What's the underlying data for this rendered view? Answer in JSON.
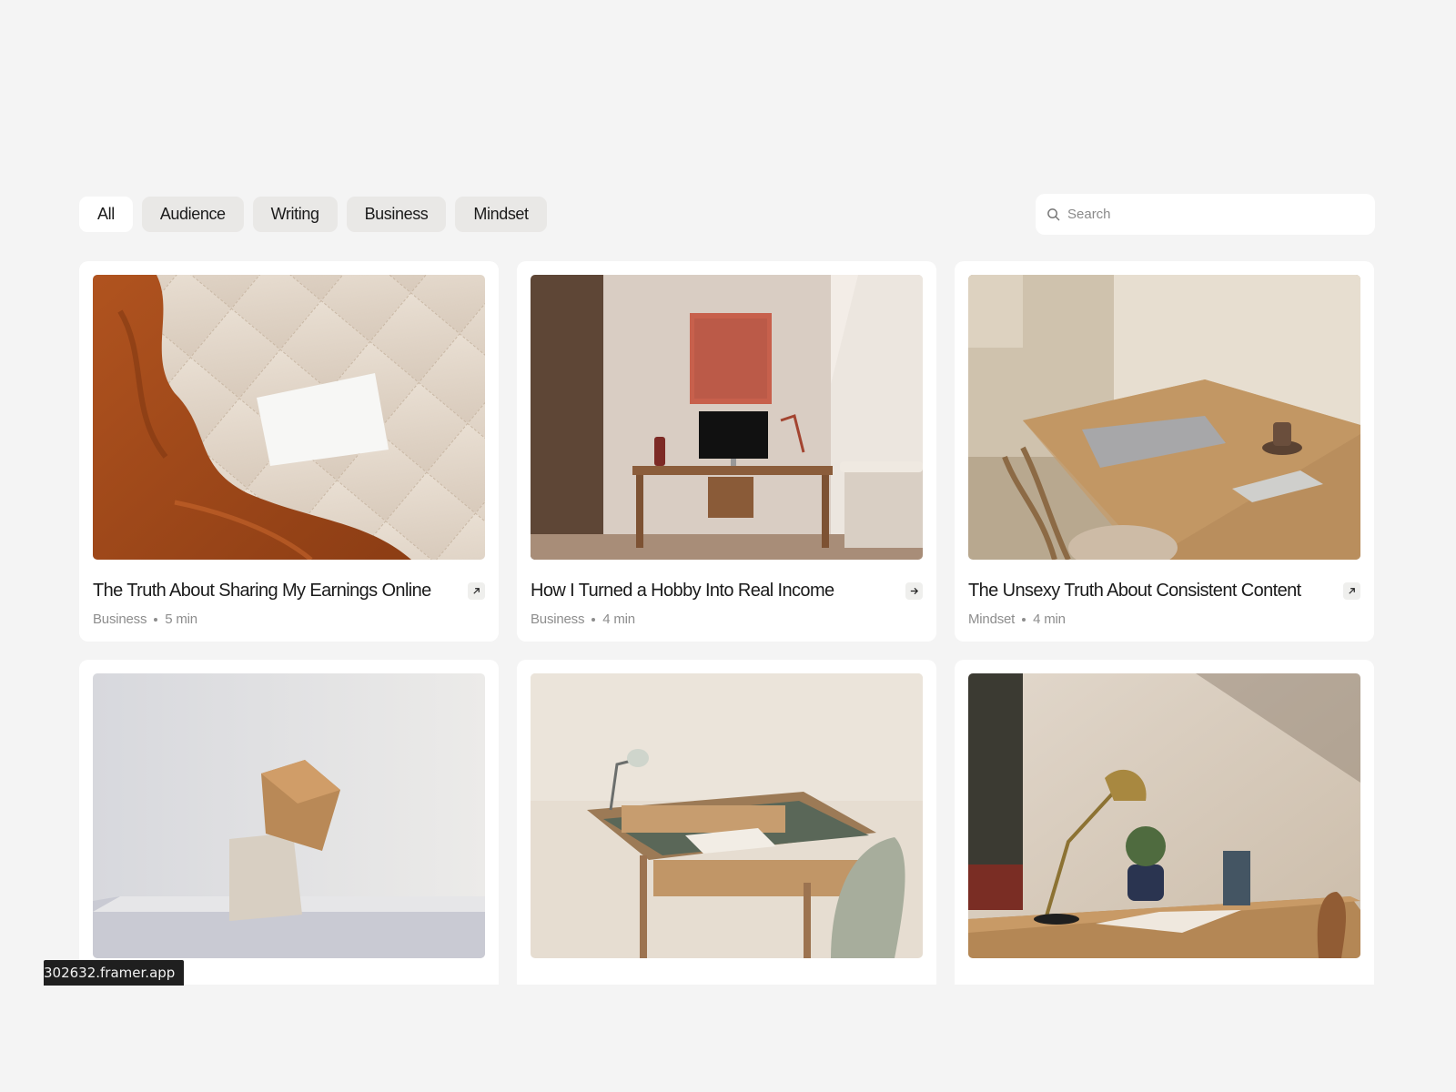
{
  "filters": {
    "chips": [
      {
        "label": "All",
        "active": true
      },
      {
        "label": "Audience",
        "active": false
      },
      {
        "label": "Writing",
        "active": false
      },
      {
        "label": "Business",
        "active": false
      },
      {
        "label": "Mindset",
        "active": false
      }
    ]
  },
  "search": {
    "placeholder": "Search",
    "icon": "search-icon"
  },
  "posts": [
    {
      "title": "The Truth About Sharing My Earnings Online",
      "category": "Business",
      "read_time": "5 min",
      "arrow_icon": "arrow-up-right-icon"
    },
    {
      "title": "How I Turned a Hobby Into Real Income",
      "category": "Business",
      "read_time": "4 min",
      "arrow_icon": "arrow-right-icon"
    },
    {
      "title": "The Unsexy Truth About Consistent Content",
      "category": "Mindset",
      "read_time": "4 min",
      "arrow_icon": "arrow-up-right-icon"
    },
    {
      "title": "",
      "category": "",
      "read_time": "",
      "arrow_icon": "arrow-up-right-icon"
    },
    {
      "title": "",
      "category": "",
      "read_time": "",
      "arrow_icon": "arrow-up-right-icon"
    },
    {
      "title": "",
      "category": "",
      "read_time": "",
      "arrow_icon": "arrow-up-right-icon"
    }
  ],
  "status_bar": {
    "url": "302632.framer.app"
  },
  "colors": {
    "background": "#f4f4f4",
    "card": "#ffffff",
    "chip": "#e9e8e6",
    "text": "#1b1b1b",
    "muted": "#8d8d8d"
  }
}
